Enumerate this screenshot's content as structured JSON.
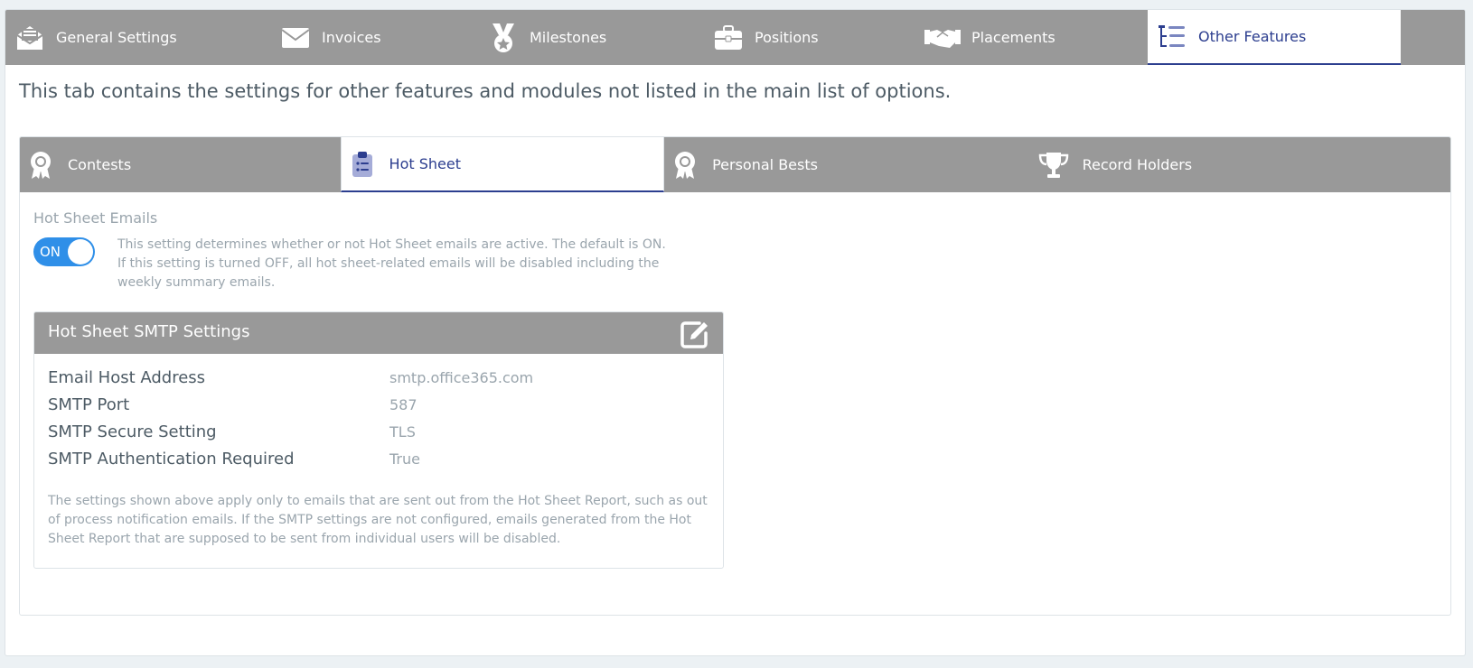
{
  "top_tabs": [
    {
      "label": "General Settings",
      "icon": "envelope-open-icon"
    },
    {
      "label": "Invoices",
      "icon": "envelope-icon"
    },
    {
      "label": "Milestones",
      "icon": "medal-icon"
    },
    {
      "label": "Positions",
      "icon": "briefcase-icon"
    },
    {
      "label": "Placements",
      "icon": "handshake-icon"
    },
    {
      "label": "Other Features",
      "icon": "list-tree-icon",
      "active": true
    }
  ],
  "intro": "This tab contains the settings for other features and modules not listed in the main list of options.",
  "sub_tabs": [
    {
      "label": "Contests",
      "icon": "award-ribbon-icon"
    },
    {
      "label": "Hot Sheet",
      "icon": "clipboard-list-icon",
      "active": true
    },
    {
      "label": "Personal Bests",
      "icon": "award-ribbon-icon"
    },
    {
      "label": "Record Holders",
      "icon": "trophy-icon"
    }
  ],
  "hot_sheet": {
    "title": "Hot Sheet Emails",
    "toggle_label": "ON",
    "description": "This setting determines whether or not Hot Sheet emails are active. The default is ON. If this setting is turned OFF, all hot sheet-related emails will be disabled including the weekly summary emails."
  },
  "smtp_card": {
    "title": "Hot Sheet SMTP Settings",
    "rows": [
      {
        "label": "Email Host Address",
        "value": "smtp.office365.com"
      },
      {
        "label": "SMTP Port",
        "value": "587"
      },
      {
        "label": "SMTP Secure Setting",
        "value": "TLS"
      },
      {
        "label": "SMTP Authentication Required",
        "value": "True"
      }
    ],
    "note": "The settings shown above apply only to emails that are sent out from the Hot Sheet Report, such as out of process notification emails. If the SMTP settings are not configured, emails generated from the Hot Sheet Report that are supposed to be sent from individual users will be disabled."
  },
  "colors": {
    "tab_bar": "#999999",
    "accent": "#2c3e8f",
    "toggle_on": "#2f8fe8"
  }
}
